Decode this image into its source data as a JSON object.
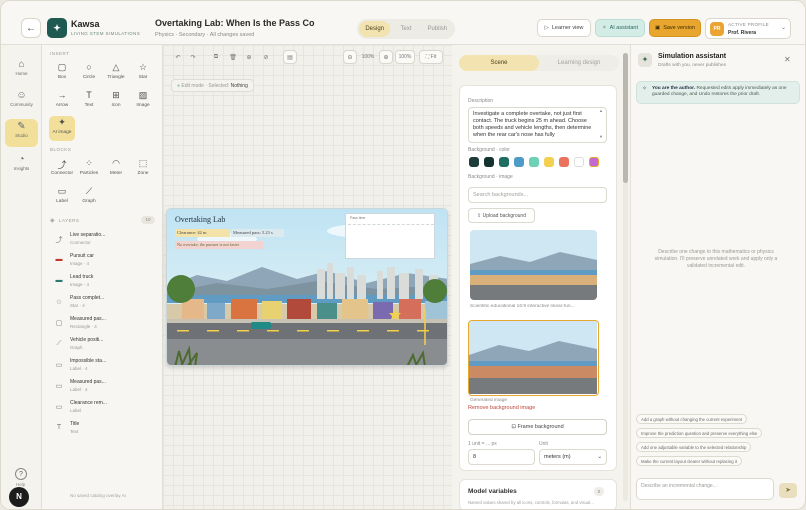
{
  "header": {
    "brand": "Kawsa",
    "brand_sub": "LIVING STEM SIMULATIONS",
    "doc_title": "Overtaking Lab: When Is the Pass Compl",
    "doc_meta": "Physics · Secondary · All changes saved",
    "modes": [
      "Design",
      "Text",
      "Publish"
    ],
    "learner_view": "Learner view",
    "ai_assistant": "AI assistant",
    "save_version": "Save version",
    "profile_label": "ACTIVE PROFILE",
    "profile_name": "Prof. Rivera",
    "profile_initials": "PR"
  },
  "leftnav": {
    "items": [
      {
        "label": "Home",
        "icon": "home-icon"
      },
      {
        "label": "Community",
        "icon": "people-icon"
      },
      {
        "label": "Studio",
        "icon": "studio-icon"
      },
      {
        "label": "Insights",
        "icon": "insights-icon"
      }
    ],
    "help_label": "Help",
    "badge": "N"
  },
  "tools": {
    "insert_label": "INSERT",
    "insert": [
      {
        "label": "Box"
      },
      {
        "label": "Circle"
      },
      {
        "label": "Triangle"
      },
      {
        "label": "Star"
      },
      {
        "label": "Arrow"
      },
      {
        "label": "Text"
      },
      {
        "label": "Icon"
      },
      {
        "label": "Image"
      },
      {
        "label": "AI image"
      }
    ],
    "blocks_label": "BLOCKS",
    "blocks": [
      {
        "label": "Connector"
      },
      {
        "label": "Particles"
      },
      {
        "label": "Meter"
      },
      {
        "label": "Zone"
      },
      {
        "label": "Label"
      },
      {
        "label": "Graph"
      }
    ],
    "layers_label": "LAYERS",
    "layers_count": "10",
    "layers": [
      {
        "name": "Live separatio...",
        "type": "Connector"
      },
      {
        "name": "Pursuit car",
        "type": "Image · 4"
      },
      {
        "name": "Lead truck",
        "type": "Image · 4"
      },
      {
        "name": "Pass complet...",
        "type": "Star · 4"
      },
      {
        "name": "Measured pas...",
        "type": "Rectangle · 4"
      },
      {
        "name": "Vehicle positi...",
        "type": "Graph"
      },
      {
        "name": "Impossible sta...",
        "type": "Label · 4"
      },
      {
        "name": "Measured pas...",
        "type": "Label · 4"
      },
      {
        "name": "Clearance rem...",
        "type": "Label"
      },
      {
        "name": "Title",
        "type": "Text"
      }
    ],
    "footer_note": "No saved catalog overlay AI"
  },
  "canvas": {
    "zoom_a": "100%",
    "zoom_b": "100%",
    "fit": "Fit",
    "edit_mode": "Edit mode · Selected:",
    "selected": "Nothing",
    "scene_title": "Overtaking Lab",
    "clearance": "Clearance: 42 m",
    "measured_pass": "Measured pass: 5.23 s",
    "no_overtake": "No overtake; the pursuer is not faster",
    "graph_label": "Pass time"
  },
  "panel": {
    "tabs": [
      "Scene",
      "Learning design"
    ],
    "description_label": "Description",
    "description": "Investigate a complete overtake, not just first contact. The truck begins 25 m ahead. Choose both speeds and vehicle lengths, then determine when the rear car's nose has fully",
    "bg_color_label": "Background · color",
    "swatches": [
      "#1e3c3a",
      "#12332f",
      "#1f6e62",
      "#4d9bc6",
      "#6ed0b4",
      "#f3cf52",
      "#e9735f",
      "#ffffff",
      "#c36ad1"
    ],
    "bg_image_label": "Background · image",
    "search_placeholder": "Search backgrounds...",
    "upload": "Upload background",
    "thumb1_caption": "Scientific-educational 16:9 interactive linear-fun...",
    "thumb2_caption": "Generated image",
    "remove": "Remove background image",
    "frame": "Frame background",
    "unit_px_label": "1 unit = ... px",
    "unit_px_value": "8",
    "unit_label": "Unit",
    "unit_value": "meters (m)",
    "model_vars": "Model variables",
    "model_vars_count": "0",
    "model_vars_sub": "Named values shared by all icons, controls, formulas, and visual..."
  },
  "assistant": {
    "title": "Simulation assistant",
    "subtitle": "Drafts with you, never publishes",
    "author_bold": "You are the author.",
    "author_text": "Requested edits apply immediately as one guarded change, and Undo restores the prior draft.",
    "empty": "Describe one change to this mathematics or physics simulation. I'll preserve unrelated work and apply only a validated incremental edit.",
    "suggestions": [
      "Add a graph without changing the current experiment",
      "Improve the prediction question and preserve everything else",
      "Add one adjustable variable to the selected relationship",
      "Make the current layout clearer without replacing it"
    ],
    "input_placeholder": "Describe an incremental change..."
  }
}
